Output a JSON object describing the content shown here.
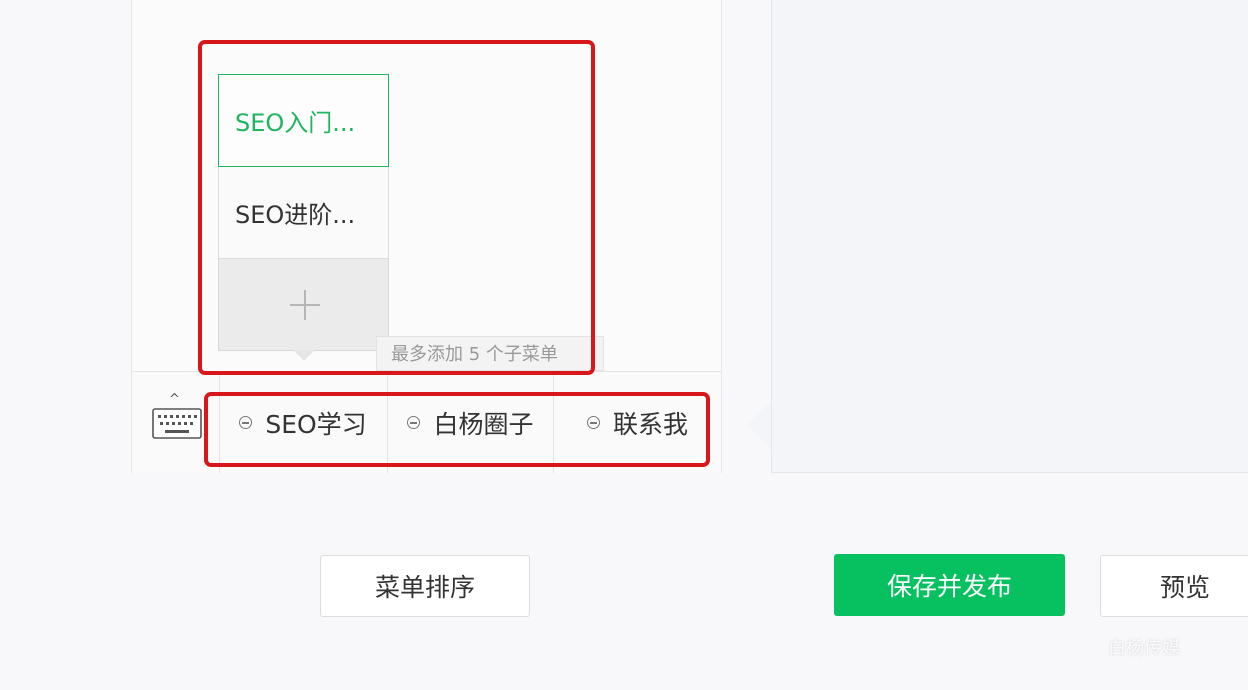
{
  "submenu": {
    "items": [
      {
        "label": "SEO入门...",
        "active": true
      },
      {
        "label": "SEO进阶...",
        "active": false
      }
    ],
    "add_icon": "plus-icon",
    "tooltip": "最多添加 5 个子菜单"
  },
  "menu_bar": {
    "keyboard_icon": "keyboard-icon",
    "caret": "^",
    "items": [
      {
        "label": "SEO学习"
      },
      {
        "label": "白杨圈子"
      },
      {
        "label": "联系我"
      }
    ]
  },
  "buttons": {
    "sort": "菜单排序",
    "save": "保存并发布",
    "preview": "预览"
  },
  "watermark": "白杨传媒",
  "colors": {
    "accent_green": "#07c160",
    "annotation_red": "#d8171b"
  }
}
